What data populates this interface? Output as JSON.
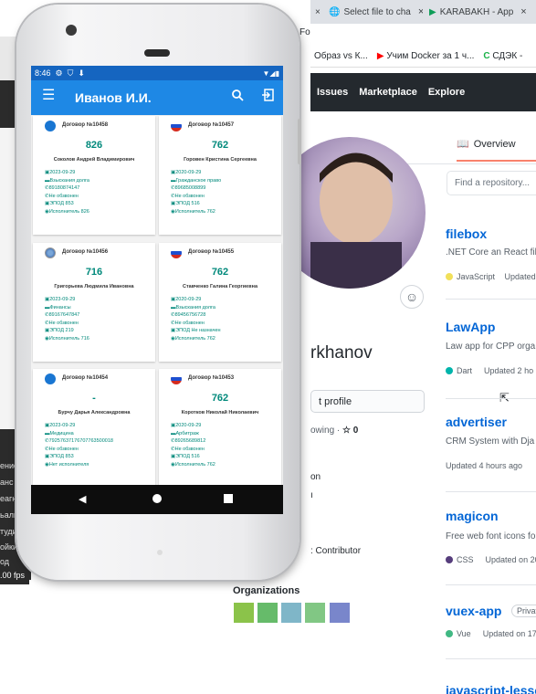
{
  "browser": {
    "tabs": [
      {
        "label": "Select file to cha",
        "close": "×"
      },
      {
        "label": "KARABAKH - App",
        "close": "×"
      }
    ],
    "tab_fragment": "Fo",
    "bookmarks": [
      "Образ vs К...",
      "Учим Docker за 1 ч...",
      "СДЭК -"
    ],
    "nav": [
      "Issues",
      "Marketplace",
      "Explore"
    ]
  },
  "github": {
    "overview_tab": "Overview",
    "find_repo_placeholder": "Find a repository...",
    "username_fragment": "rkhanov",
    "edit_profile": "t profile",
    "follow_fragment": "owing ·",
    "stars": "☆ 0",
    "on_fragment": "on",
    "contributor": ": Contributor",
    "organizations": "Organizations",
    "repos": [
      {
        "name": "filebox",
        "desc": ".NET Core an React fil",
        "lang": "JavaScript",
        "lang_color": "#f1e05a",
        "updated": "Updated"
      },
      {
        "name": "LawApp",
        "desc": "Law app for CPP orga",
        "lang": "Dart",
        "lang_color": "#00B4AB",
        "updated": "Updated 2 ho"
      },
      {
        "name": "advertiser",
        "desc": "CRM System with Dja",
        "lang": "",
        "lang_color": "",
        "updated": "Updated 4 hours ago"
      },
      {
        "name": "magicon",
        "desc": "Free web font icons fo",
        "lang": "CSS",
        "lang_color": "#563d7c",
        "updated": "Updated on 20"
      },
      {
        "name": "vuex-app",
        "desc": "",
        "lang": "Vue",
        "lang_color": "#41b883",
        "updated": "Updated on 17",
        "badge": "Privat"
      },
      {
        "name": "javascript-lesso",
        "desc": "",
        "lang": "",
        "lang_color": "",
        "updated": ""
      }
    ]
  },
  "left_menu": [
    "ение",
    "анс",
    "еагн",
    "ьаль",
    "тудио",
    "ойки",
    "од"
  ],
  "fps_label": ".00 fps",
  "phone": {
    "status": {
      "time": "8:46"
    },
    "appbar": {
      "title": "Иванов И.И."
    },
    "cards": [
      {
        "title": "Договор №10458",
        "number": "826",
        "name": "Соколов Андрей Владимирович",
        "flag": "blue",
        "lines": [
          "2023-09-29",
          "Взыскания долга",
          "89180874147",
          "Не обзвонен",
          "ЭПОД 853",
          "Исполнитель 826"
        ]
      },
      {
        "title": "Договор №10457",
        "number": "762",
        "name": "Горовен Кристина Сергеевна",
        "flag": "ru",
        "lines": [
          "2020-09-29",
          "Гражданское право",
          "89685008899",
          "Не обзвонен",
          "ЭПОД 516",
          "Исполнитель 762"
        ]
      },
      {
        "title": "Договор №10456",
        "number": "716",
        "name": "Григорьева Людмила Ивановна",
        "flag": "globe",
        "lines": [
          "2023-09-29",
          "Финансы",
          "89167647847",
          "Не обзвонен",
          "ЭПОД 219",
          "Исполнитель 716"
        ]
      },
      {
        "title": "Договор №10455",
        "number": "762",
        "name": "Ставченко Галина Георгиевна",
        "flag": "ru",
        "lines": [
          "2020-09-29",
          "Взыскания долга",
          "89456756728",
          "Не обзвонен",
          "ЭПОД Не назначен",
          "Исполнитель 762"
        ]
      },
      {
        "title": "Договор №10454",
        "number": "-",
        "name": "Бурчу Дарья Александровна",
        "flag": "blue",
        "lines": [
          "2023-09-29",
          "Медицина",
          "79257637176707763500018",
          "Не обзвонен",
          "ЭПОД 853",
          "Нет исполнителя"
        ]
      },
      {
        "title": "Договор №10453",
        "number": "762",
        "name": "Коротков Николай Николаевич",
        "flag": "ru",
        "lines": [
          "2020-09-29",
          "Арбитраж",
          "89265689812",
          "Не обзвонен",
          "ЭПОД 516",
          "Исполнитель 762"
        ]
      }
    ]
  }
}
